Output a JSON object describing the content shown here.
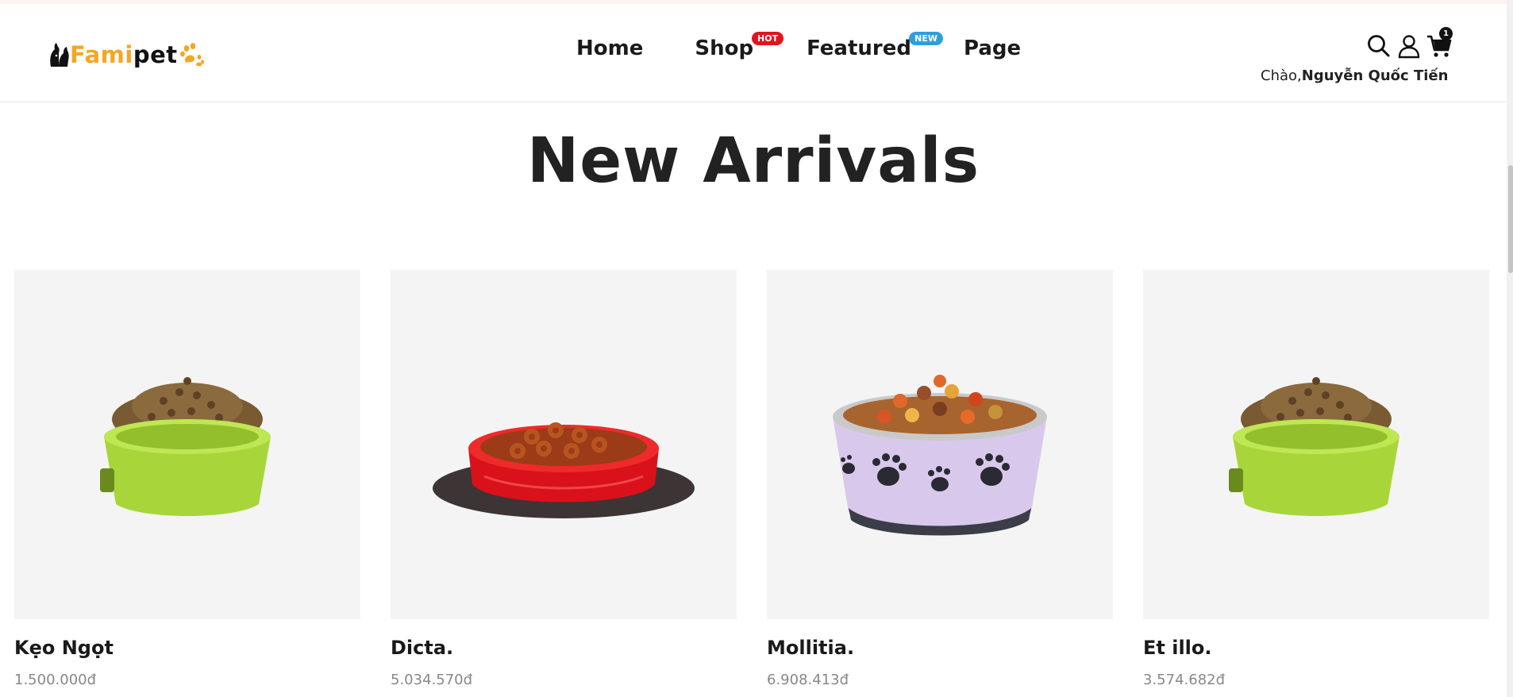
{
  "header": {
    "logo": {
      "part1": "Fami",
      "part2": "pet"
    },
    "nav": [
      {
        "label": "Home"
      },
      {
        "label": "Shop",
        "badge": "HOT"
      },
      {
        "label": "Featured",
        "badge": "NEW"
      },
      {
        "label": "Page"
      }
    ],
    "cart_count": "1",
    "greeting_prefix": "Chào,",
    "user_name": "Nguyễn Quốc Tiến",
    "icons": [
      "search-icon",
      "user-icon",
      "cart-icon"
    ]
  },
  "section": {
    "title": "New Arrivals"
  },
  "products": [
    {
      "name": "Kẹo Ngọt",
      "price": "1.500.000đ",
      "bowl": "green"
    },
    {
      "name": "Dicta.",
      "price": "5.034.570đ",
      "bowl": "red"
    },
    {
      "name": "Mollitia.",
      "price": "6.908.413đ",
      "bowl": "lilac"
    },
    {
      "name": "Et illo.",
      "price": "3.574.682đ",
      "bowl": "green"
    }
  ],
  "colors": {
    "accent": "#f5a623",
    "hot": "#e3141c",
    "new": "#2f9fdc",
    "card_bg": "#f4f4f4"
  }
}
